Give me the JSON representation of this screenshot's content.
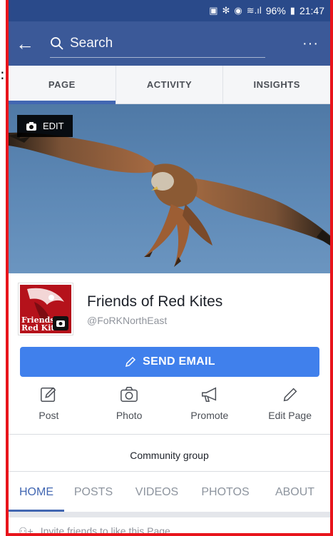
{
  "status_bar": {
    "battery": "96%",
    "time": "21:47"
  },
  "header": {
    "search_placeholder": "Search",
    "more": "···"
  },
  "page_tabs": [
    {
      "label": "PAGE"
    },
    {
      "label": "ACTIVITY"
    },
    {
      "label": "INSIGHTS"
    }
  ],
  "cover": {
    "edit_label": "EDIT"
  },
  "profile": {
    "name": "Friends of Red Kites",
    "handle": "@FoRKNorthEast",
    "avatar_text_1": "Friends",
    "avatar_text_2": "Red Kites"
  },
  "send_email": {
    "label": "SEND EMAIL"
  },
  "actions": [
    {
      "label": "Post",
      "icon": "post-icon"
    },
    {
      "label": "Photo",
      "icon": "camera-icon"
    },
    {
      "label": "Promote",
      "icon": "megaphone-icon"
    },
    {
      "label": "Edit Page",
      "icon": "pencil-icon"
    }
  ],
  "category": "Community group",
  "content_tabs": [
    {
      "label": "HOME"
    },
    {
      "label": "POSTS"
    },
    {
      "label": "VIDEOS"
    },
    {
      "label": "PHOTOS"
    },
    {
      "label": "ABOUT"
    }
  ],
  "invite_text": "Invite friends to like this Page",
  "colors": {
    "brand": "#3b5998",
    "accent": "#4080ec",
    "border": "#e8141b"
  }
}
